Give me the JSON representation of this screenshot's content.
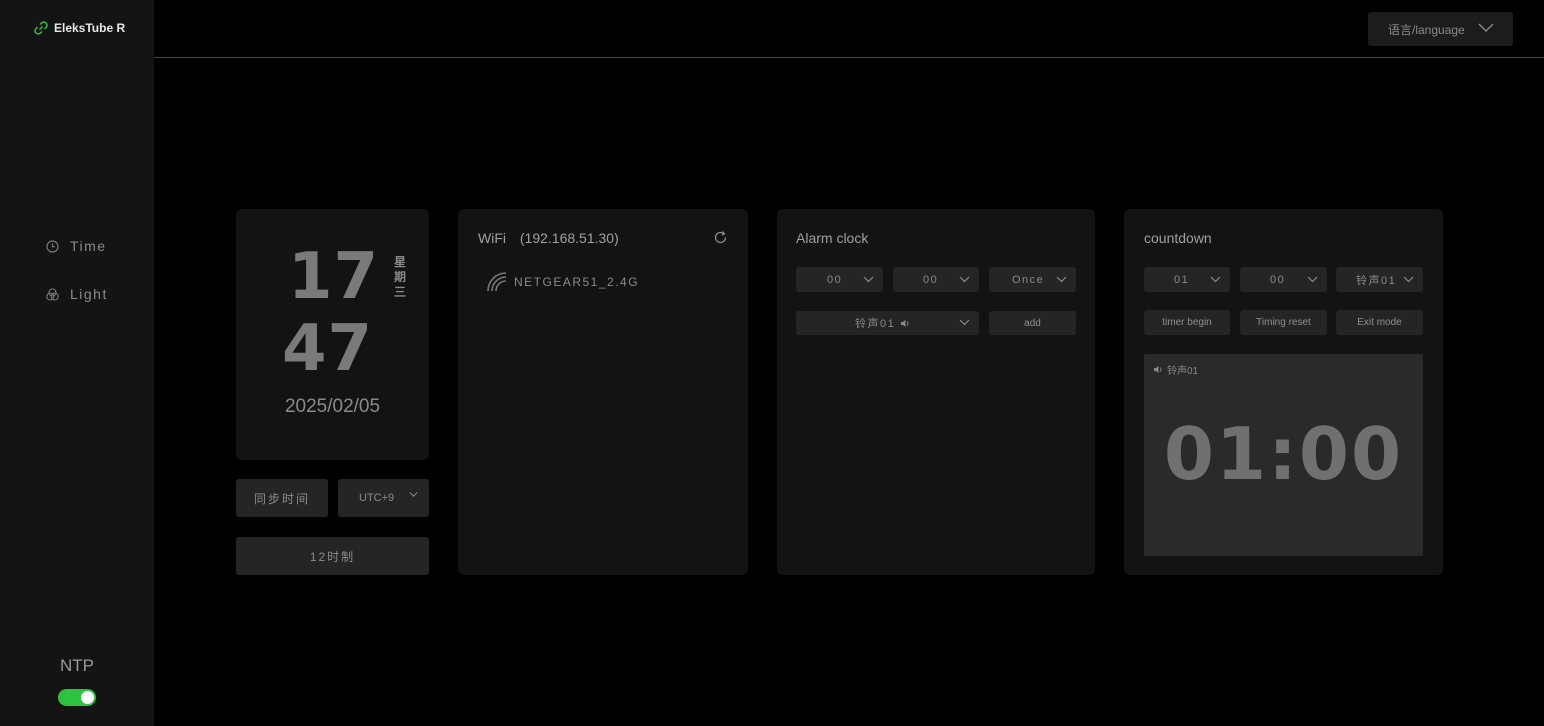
{
  "app": {
    "title": "EleksTube R",
    "accent": "#2ec33f"
  },
  "sidebar": {
    "items": [
      {
        "label": "Time",
        "icon": "clock-icon"
      },
      {
        "label": "Light",
        "icon": "light-icon"
      }
    ],
    "ntp": {
      "label": "NTP",
      "enabled": true
    }
  },
  "header": {
    "language_label": "语言/language"
  },
  "clock": {
    "hours": "17",
    "minutes": "47",
    "weekday": [
      "星",
      "期",
      "三"
    ],
    "date": "2025/02/05",
    "sync_button": "同步时间",
    "timezone": "UTC+9",
    "mode_button": "12时制"
  },
  "wifi": {
    "title": "WiFi",
    "ip": "(192.168.51.30)",
    "network": "NETGEAR51_2.4G"
  },
  "alarm": {
    "title": "Alarm clock",
    "hour": "00",
    "minute": "00",
    "repeat": "Once",
    "ringtone": "铃声01",
    "add_button": "add"
  },
  "countdown": {
    "title": "countdown",
    "minute": "01",
    "second": "00",
    "ringtone": "铃声01",
    "begin_button": "timer begin",
    "reset_button": "Timing reset",
    "exit_button": "Exit mode",
    "display_ringtone": "铃声01",
    "display_time": "01:00"
  }
}
